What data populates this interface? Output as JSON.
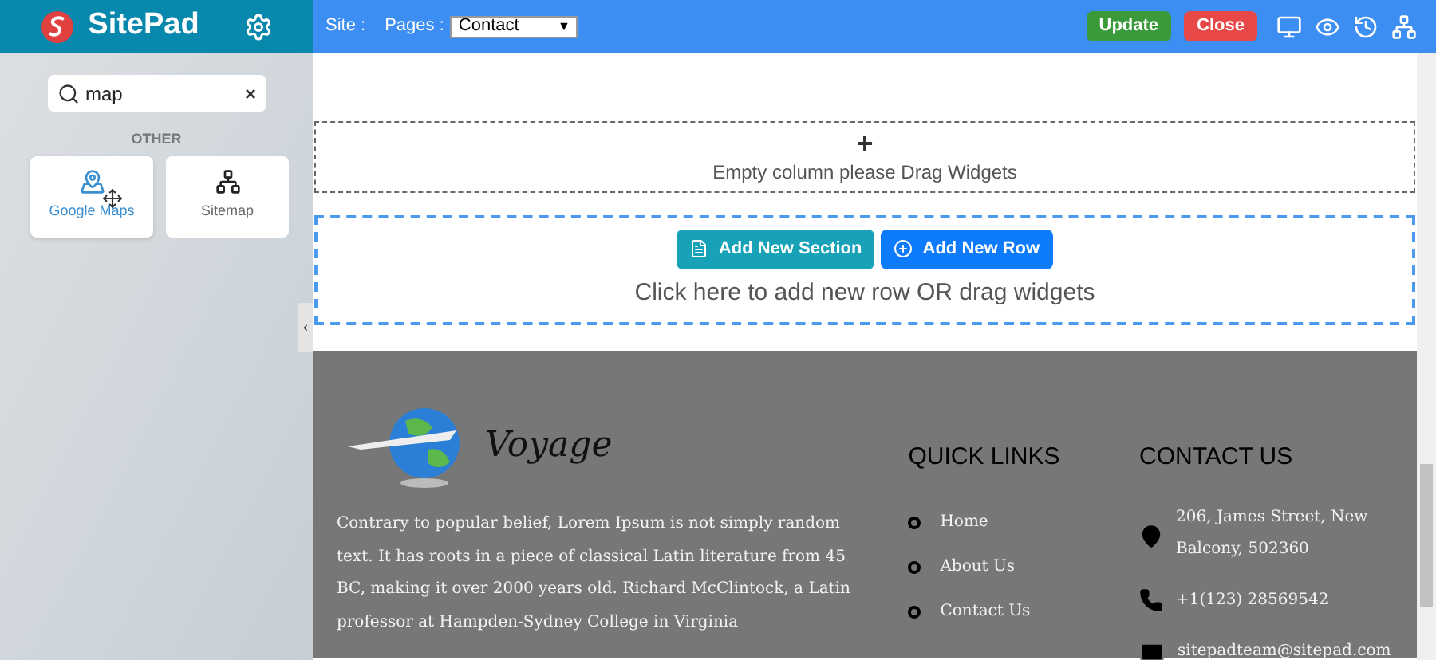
{
  "brand": {
    "name": "SitePad"
  },
  "topbar": {
    "site_label": "Site :",
    "pages_label": "Pages :",
    "page_select": "Contact",
    "select_caret": "▼",
    "buttons": [
      {
        "label": "Update",
        "kind": "update"
      },
      {
        "label": "Close",
        "kind": "close"
      }
    ]
  },
  "sidebar": {
    "search": {
      "value": "map"
    },
    "clear": "×",
    "section": "OTHER",
    "widgets": [
      {
        "label": "Google Maps",
        "kind": "map",
        "dragging": true
      },
      {
        "label": "Sitemap",
        "kind": "sitemap",
        "dragging": false
      }
    ],
    "collapse": "‹"
  },
  "canvas": {
    "empty_column": {
      "plus": "+",
      "text": "Empty column please Drag Widgets"
    },
    "add_section": "Add New Section",
    "add_row": "Add New Row",
    "hint": "Click here to add new row OR drag widgets"
  },
  "footer": {
    "logo_text": "Voyage",
    "about": "Contrary to popular belief, Lorem Ipsum is not simply random text. It has roots in a piece of classical Latin literature from 45 BC, making it over 2000 years old. Richard McClintock, a Latin professor at Hampden-Sydney College in Virginia",
    "quick_links": {
      "title": "QUICK LINKS",
      "items": [
        "Home",
        "About Us",
        "Contact Us"
      ]
    },
    "contact": {
      "title": "CONTACT US",
      "items": [
        {
          "kind": "address",
          "text": "206, James Street, New Balcony, 502360"
        },
        {
          "kind": "phone",
          "text": "+1(123) 28569542"
        },
        {
          "kind": "email",
          "text": "sitepadteam@sitepad.com"
        }
      ]
    }
  }
}
